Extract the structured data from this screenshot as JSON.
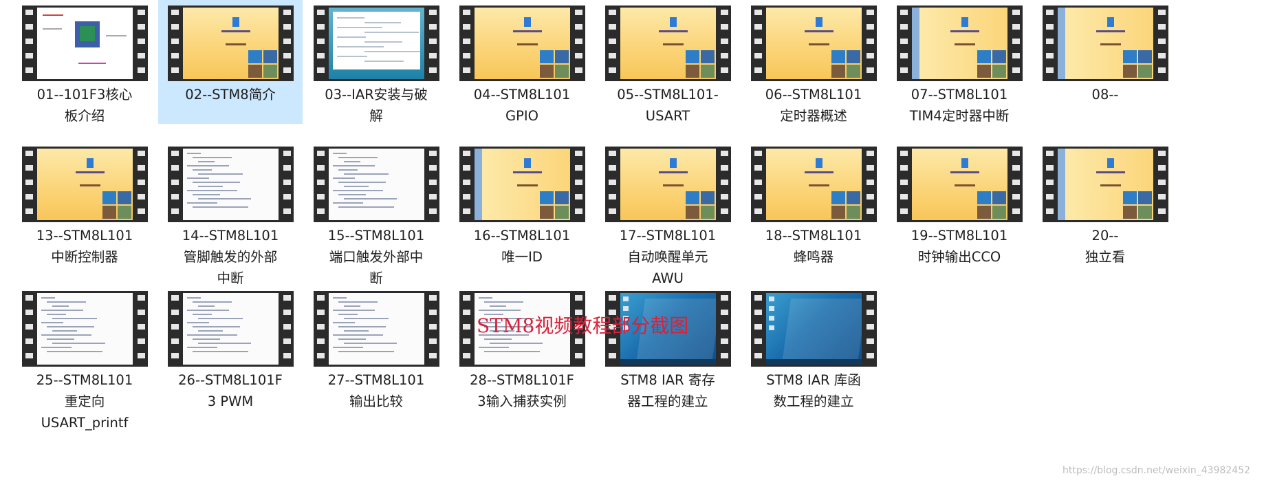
{
  "videos": [
    {
      "label": "01--101F3核心\n板介绍",
      "thumb": "board",
      "selected": false
    },
    {
      "label": "02--STM8简介",
      "thumb": "ppt",
      "selected": true
    },
    {
      "label": "03--IAR安装与破\n解",
      "thumb": "iar",
      "selected": false
    },
    {
      "label": "04--STM8L101\nGPIO",
      "thumb": "ppt",
      "selected": false
    },
    {
      "label": "05--STM8L101-\nUSART",
      "thumb": "ppt",
      "selected": false
    },
    {
      "label": "06--STM8L101\n定时器概述",
      "thumb": "ppt",
      "selected": false
    },
    {
      "label": "07--STM8L101\nTIM4定时器中断",
      "thumb": "ppt-blue",
      "selected": false
    },
    {
      "label": "08--",
      "thumb": "ppt-blue",
      "selected": false
    },
    {
      "label": "13--STM8L101\n中断控制器",
      "thumb": "ppt",
      "selected": false
    },
    {
      "label": "14--STM8L101\n管脚触发的外部\n中断",
      "thumb": "doc",
      "selected": false
    },
    {
      "label": "15--STM8L101\n端口触发外部中\n断",
      "thumb": "doc",
      "selected": false
    },
    {
      "label": "16--STM8L101\n唯一ID",
      "thumb": "ppt-blue",
      "selected": false
    },
    {
      "label": "17--STM8L101\n自动唤醒单元\nAWU",
      "thumb": "ppt",
      "selected": false
    },
    {
      "label": "18--STM8L101\n蜂鸣器",
      "thumb": "ppt",
      "selected": false
    },
    {
      "label": "19--STM8L101\n时钟输出CCO",
      "thumb": "ppt",
      "selected": false
    },
    {
      "label": "20--\n独立看",
      "thumb": "ppt-blue",
      "selected": false
    },
    {
      "label": "25--STM8L101\n重定向\nUSART_printf",
      "thumb": "doc",
      "selected": false
    },
    {
      "label": "26--STM8L101F\n3 PWM",
      "thumb": "doc",
      "selected": false
    },
    {
      "label": "27--STM8L101\n输出比较",
      "thumb": "doc",
      "selected": false
    },
    {
      "label": "28--STM8L101F\n3输入捕获实例",
      "thumb": "doc",
      "selected": false
    },
    {
      "label": "STM8 IAR 寄存\n器工程的建立",
      "thumb": "win",
      "selected": false
    },
    {
      "label": "STM8 IAR 库函\n数工程的建立",
      "thumb": "win",
      "selected": false
    }
  ],
  "overlay_title": "STM8视频教程部分截图",
  "watermark": "https://blog.csdn.net/weixin_43982452"
}
